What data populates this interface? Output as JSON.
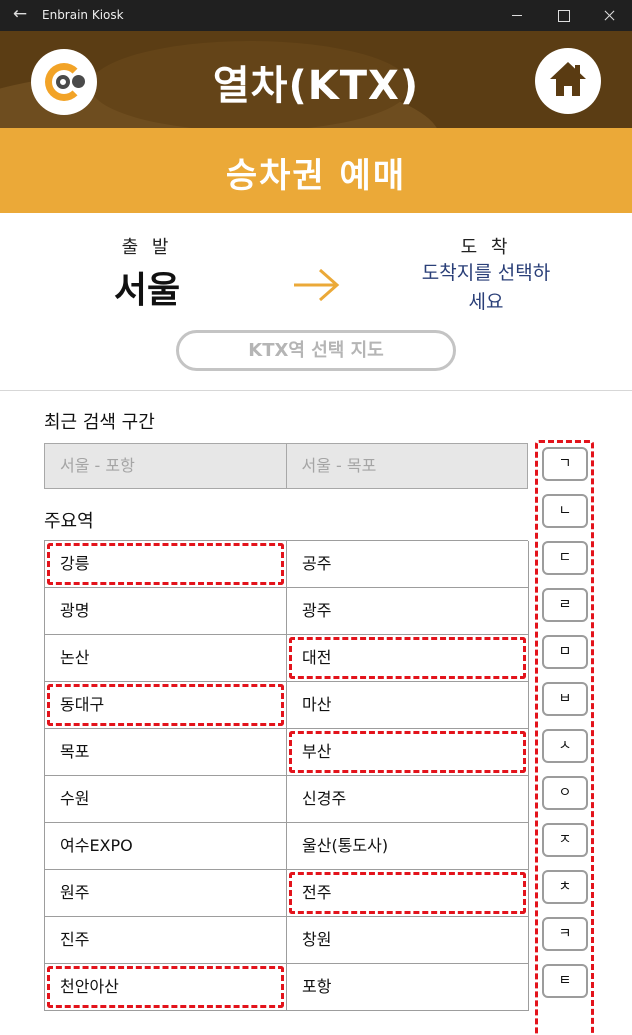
{
  "window": {
    "title": "Enbrain Kiosk",
    "back_icon": "back-arrow-icon"
  },
  "header": {
    "title": "열차(KTX)",
    "logo_icon": "enbrain-logo-icon",
    "home_icon": "home-icon"
  },
  "subheader": {
    "title": "승차권 예매"
  },
  "route": {
    "departure_label": "출 발",
    "departure_station": "서울",
    "arrival_label": "도 착",
    "arrival_prompt": "도착지를 선택하세요",
    "arrow_icon": "right-arrow-icon",
    "map_button": "KTX역 선택 지도",
    "colors": {
      "accent": "#eba938",
      "prompt": "#2a3f78"
    }
  },
  "recent": {
    "title": "최근 검색 구간",
    "items": [
      "서울 - 포항",
      "서울 - 목포"
    ]
  },
  "major": {
    "title": "주요역",
    "stations": [
      "강릉",
      "공주",
      "광명",
      "광주",
      "논산",
      "대전",
      "동대구",
      "마산",
      "목포",
      "부산",
      "수원",
      "신경주",
      "여수EXPO",
      "울산(통도사)",
      "원주",
      "전주",
      "진주",
      "창원",
      "천안아산",
      "포항"
    ],
    "highlighted": [
      "강릉",
      "대전",
      "동대구",
      "부산",
      "전주",
      "천안아산"
    ],
    "highlight_color": "#e3131b"
  },
  "consonants": [
    "ㄱ",
    "ㄴ",
    "ㄷ",
    "ㄹ",
    "ㅁ",
    "ㅂ",
    "ㅅ",
    "ㅇ",
    "ㅈ",
    "ㅊ",
    "ㅋ",
    "ㅌ"
  ]
}
